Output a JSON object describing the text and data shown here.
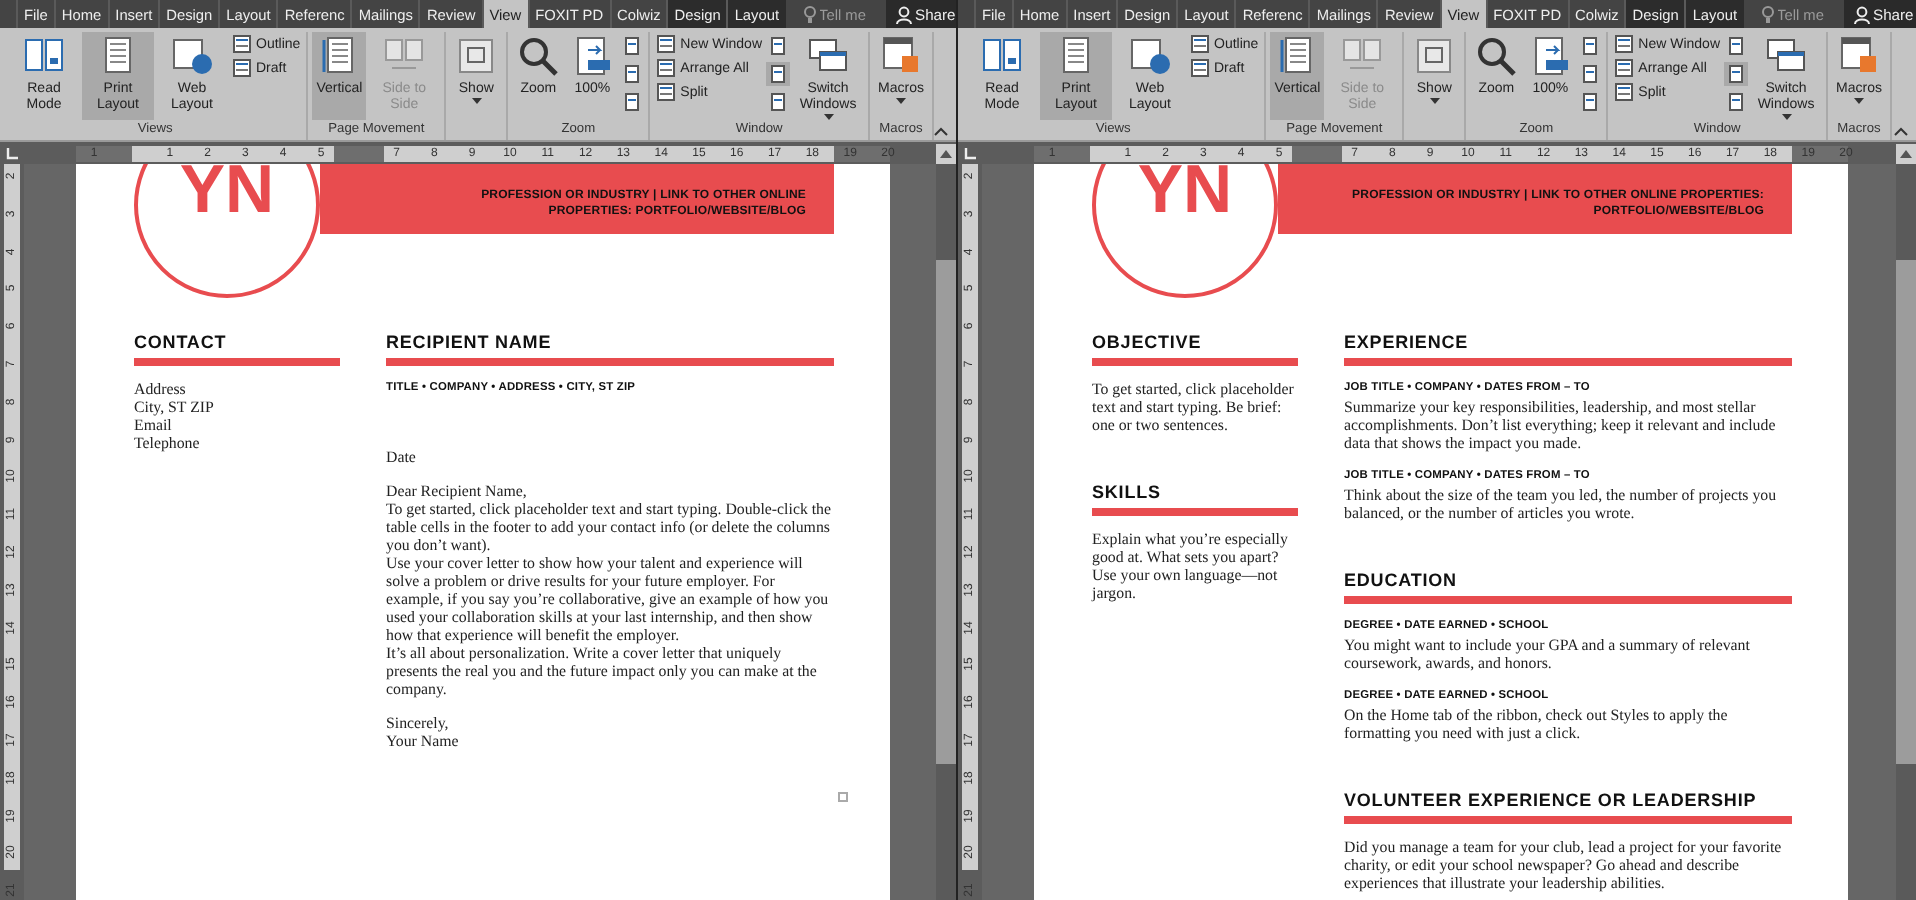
{
  "windows": [
    {
      "tabs": [
        {
          "label": "File",
          "selected": false,
          "kind": "normal"
        },
        {
          "label": "Home",
          "selected": false,
          "kind": "normal"
        },
        {
          "label": "Insert",
          "selected": false,
          "kind": "normal"
        },
        {
          "label": "Design",
          "selected": false,
          "kind": "normal"
        },
        {
          "label": "Layout",
          "selected": false,
          "kind": "normal"
        },
        {
          "label": "Referenc",
          "selected": false,
          "kind": "normal"
        },
        {
          "label": "Mailings",
          "selected": false,
          "kind": "normal"
        },
        {
          "label": "Review",
          "selected": false,
          "kind": "normal"
        },
        {
          "label": "View",
          "selected": true,
          "kind": "normal"
        },
        {
          "label": "FOXIT PD",
          "selected": false,
          "kind": "normal"
        },
        {
          "label": "Colwiz",
          "selected": false,
          "kind": "normal"
        },
        {
          "label": "Design",
          "selected": false,
          "kind": "contextual"
        },
        {
          "label": "Layout",
          "selected": false,
          "kind": "contextual"
        }
      ],
      "tell_me": {
        "placeholder": "Tell me"
      },
      "share_button": "Share",
      "ribbon": {
        "groups": [
          {
            "label": "Views",
            "items": [
              {
                "kind": "large",
                "label": "Read Mode",
                "selected": false,
                "disabled": false,
                "dropdown": false
              },
              {
                "kind": "large",
                "label": "Print Layout",
                "selected": true,
                "disabled": false,
                "dropdown": false
              },
              {
                "kind": "large",
                "label": "Web Layout",
                "selected": false,
                "disabled": false,
                "dropdown": false
              },
              {
                "kind": "stack",
                "items": [
                  {
                    "label": "Outline"
                  },
                  {
                    "label": "Draft"
                  }
                ]
              }
            ]
          },
          {
            "label": "Page Movement",
            "items": [
              {
                "kind": "large",
                "label": "Vertical",
                "selected": true,
                "disabled": false,
                "dropdown": false
              },
              {
                "kind": "large",
                "label": "Side to Side",
                "selected": false,
                "disabled": true,
                "dropdown": false
              }
            ]
          },
          {
            "items": [
              {
                "kind": "large",
                "label": "Show",
                "selected": false,
                "disabled": false,
                "dropdown": true
              }
            ]
          },
          {
            "label": "Zoom",
            "items": [
              {
                "kind": "large",
                "label": "Zoom",
                "selected": false,
                "disabled": false,
                "dropdown": false
              },
              {
                "kind": "large",
                "label": "100%",
                "selected": false,
                "disabled": false,
                "dropdown": false
              },
              {
                "kind": "icon_stack",
                "buttons": [
                  {
                    "selected": false
                  },
                  {
                    "selected": false
                  },
                  {
                    "selected": false
                  }
                ]
              }
            ]
          },
          {
            "label": "Window",
            "items": [
              {
                "kind": "stack",
                "items": [
                  {
                    "label": "New Window"
                  },
                  {
                    "label": "Arrange All"
                  },
                  {
                    "label": "Split"
                  }
                ]
              },
              {
                "kind": "icon_stack",
                "buttons": [
                  {
                    "selected": false
                  },
                  {
                    "selected": true
                  },
                  {
                    "selected": false
                  }
                ]
              },
              {
                "kind": "large",
                "label": "Switch Windows",
                "selected": false,
                "disabled": false,
                "dropdown": true
              }
            ]
          },
          {
            "label": "Macros",
            "items": [
              {
                "kind": "large",
                "label": "Macros",
                "selected": false,
                "disabled": false,
                "dropdown": true
              }
            ]
          }
        ]
      },
      "ruler": {
        "horizontal": [
          "1",
          "1",
          "2",
          "3",
          "4",
          "5",
          "7",
          "8",
          "9",
          "10",
          "11",
          "12",
          "13",
          "14",
          "15",
          "16",
          "17",
          "18",
          "19",
          "20"
        ],
        "vertical": [
          "2",
          "3",
          "4",
          "5",
          "6",
          "7",
          "8",
          "9",
          "10",
          "11",
          "12",
          "13",
          "14",
          "15",
          "16",
          "17",
          "18",
          "19",
          "20",
          "21"
        ]
      },
      "document": {
        "monogram": "YN",
        "header_lines": [
          "PROFESSION OR INDUSTRY | LINK TO OTHER ONLINE",
          "PROPERTIES: PORTFOLIO/WEBSITE/BLOG"
        ],
        "end_mark": true,
        "left_column": [
          {
            "heading": "CONTACT",
            "blocks": [
              {
                "kind": "text",
                "lines": [
                  "Address",
                  "City, ST ZIP",
                  "Email",
                  "Telephone"
                ]
              }
            ]
          }
        ],
        "right_column": [
          {
            "heading": "RECIPIENT NAME",
            "blocks": [
              {
                "kind": "address_line",
                "text": "TITLE • COMPANY • ADDRESS • CITY, ST ZIP"
              },
              {
                "kind": "text",
                "lines": [
                  "Date"
                ]
              },
              {
                "kind": "text",
                "lines": [
                  "Dear Recipient Name,",
                  "To get started, click placeholder text and start typing. Double-click the table cells in the footer to add your contact info (or delete the columns you don’t want).",
                  "Use your cover letter to show how your talent and experience will solve a problem or drive results for your future employer. For example, if you say you’re collaborative, give an example of how you used your collaboration skills at your last internship, and then show how that experience will benefit the employer.",
                  "It’s all about personalization. Write a cover letter that uniquely presents the real you and the future impact only you can make at the company."
                ]
              },
              {
                "kind": "text",
                "lines": [
                  "Sincerely,",
                  "Your Name"
                ]
              }
            ]
          }
        ]
      }
    },
    {
      "tabs": [
        {
          "label": "File",
          "selected": false,
          "kind": "normal"
        },
        {
          "label": "Home",
          "selected": false,
          "kind": "normal"
        },
        {
          "label": "Insert",
          "selected": false,
          "kind": "normal"
        },
        {
          "label": "Design",
          "selected": false,
          "kind": "normal"
        },
        {
          "label": "Layout",
          "selected": false,
          "kind": "normal"
        },
        {
          "label": "Referenc",
          "selected": false,
          "kind": "normal"
        },
        {
          "label": "Mailings",
          "selected": false,
          "kind": "normal"
        },
        {
          "label": "Review",
          "selected": false,
          "kind": "normal"
        },
        {
          "label": "View",
          "selected": true,
          "kind": "normal"
        },
        {
          "label": "FOXIT PD",
          "selected": false,
          "kind": "normal"
        },
        {
          "label": "Colwiz",
          "selected": false,
          "kind": "normal"
        },
        {
          "label": "Design",
          "selected": false,
          "kind": "contextual"
        },
        {
          "label": "Layout",
          "selected": false,
          "kind": "contextual"
        }
      ],
      "tell_me": {
        "placeholder": "Tell me"
      },
      "share_button": "Share",
      "ribbon": {
        "groups": [
          {
            "label": "Views",
            "items": [
              {
                "kind": "large",
                "label": "Read Mode",
                "selected": false,
                "disabled": false,
                "dropdown": false
              },
              {
                "kind": "large",
                "label": "Print Layout",
                "selected": true,
                "disabled": false,
                "dropdown": false
              },
              {
                "kind": "large",
                "label": "Web Layout",
                "selected": false,
                "disabled": false,
                "dropdown": false
              },
              {
                "kind": "stack",
                "items": [
                  {
                    "label": "Outline"
                  },
                  {
                    "label": "Draft"
                  }
                ]
              }
            ]
          },
          {
            "label": "Page Movement",
            "items": [
              {
                "kind": "large",
                "label": "Vertical",
                "selected": true,
                "disabled": false,
                "dropdown": false
              },
              {
                "kind": "large",
                "label": "Side to Side",
                "selected": false,
                "disabled": true,
                "dropdown": false
              }
            ]
          },
          {
            "items": [
              {
                "kind": "large",
                "label": "Show",
                "selected": false,
                "disabled": false,
                "dropdown": true
              }
            ]
          },
          {
            "label": "Zoom",
            "items": [
              {
                "kind": "large",
                "label": "Zoom",
                "selected": false,
                "disabled": false,
                "dropdown": false
              },
              {
                "kind": "large",
                "label": "100%",
                "selected": false,
                "disabled": false,
                "dropdown": false
              },
              {
                "kind": "icon_stack",
                "buttons": [
                  {
                    "selected": false
                  },
                  {
                    "selected": false
                  },
                  {
                    "selected": false
                  }
                ]
              }
            ]
          },
          {
            "label": "Window",
            "items": [
              {
                "kind": "stack",
                "items": [
                  {
                    "label": "New Window"
                  },
                  {
                    "label": "Arrange All"
                  },
                  {
                    "label": "Split"
                  }
                ]
              },
              {
                "kind": "icon_stack",
                "buttons": [
                  {
                    "selected": false
                  },
                  {
                    "selected": true
                  },
                  {
                    "selected": false
                  }
                ]
              },
              {
                "kind": "large",
                "label": "Switch Windows",
                "selected": false,
                "disabled": false,
                "dropdown": true
              }
            ]
          },
          {
            "label": "Macros",
            "items": [
              {
                "kind": "large",
                "label": "Macros",
                "selected": false,
                "disabled": false,
                "dropdown": true
              }
            ]
          }
        ]
      },
      "ruler": {
        "horizontal": [
          "1",
          "1",
          "2",
          "3",
          "4",
          "5",
          "7",
          "8",
          "9",
          "10",
          "11",
          "12",
          "13",
          "14",
          "15",
          "16",
          "17",
          "18",
          "19",
          "20"
        ],
        "vertical": [
          "2",
          "3",
          "4",
          "5",
          "6",
          "7",
          "8",
          "9",
          "10",
          "11",
          "12",
          "13",
          "14",
          "15",
          "16",
          "17",
          "18",
          "19",
          "20",
          "21"
        ]
      },
      "document": {
        "monogram": "YN",
        "header_lines": [
          "PROFESSION OR INDUSTRY | LINK TO OTHER ONLINE PROPERTIES:",
          "PORTFOLIO/WEBSITE/BLOG"
        ],
        "end_mark": false,
        "left_column": [
          {
            "heading": "OBJECTIVE",
            "blocks": [
              {
                "kind": "text",
                "lines": [
                  "To get started, click placeholder text and start typing. Be brief: one or two sentences."
                ]
              }
            ]
          },
          {
            "heading": "SKILLS",
            "blocks": [
              {
                "kind": "text",
                "lines": [
                  "Explain what you’re especially good at. What sets you apart? Use your own language—not jargon."
                ]
              }
            ]
          }
        ],
        "right_column": [
          {
            "heading": "EXPERIENCE",
            "blocks": [
              {
                "kind": "subhead",
                "text": "JOB TITLE • COMPANY • DATES FROM – TO"
              },
              {
                "kind": "text",
                "lines": [
                  "Summarize your key responsibilities, leadership, and most stellar accomplishments. Don’t list everything; keep it relevant and include data that shows the impact you made."
                ]
              },
              {
                "kind": "subhead",
                "text": "JOB TITLE • COMPANY • DATES FROM – TO"
              },
              {
                "kind": "text",
                "lines": [
                  "Think about the size of the team you led, the number of projects you balanced, or the number of articles you wrote."
                ]
              }
            ]
          },
          {
            "heading": "EDUCATION",
            "blocks": [
              {
                "kind": "subhead",
                "text": "DEGREE • DATE EARNED • SCHOOL"
              },
              {
                "kind": "text",
                "lines": [
                  "You might want to include your GPA and a summary of relevant coursework, awards, and honors."
                ]
              },
              {
                "kind": "subhead",
                "text": "DEGREE • DATE EARNED • SCHOOL"
              },
              {
                "kind": "text",
                "lines": [
                  "On the Home tab of the ribbon, check out Styles to apply the formatting you need with just a click."
                ]
              }
            ]
          },
          {
            "heading": "VOLUNTEER EXPERIENCE OR LEADERSHIP",
            "blocks": [
              {
                "kind": "text",
                "lines": [
                  "Did you manage a team for your club, lead a project for your favorite charity, or edit your school newspaper? Go ahead and describe experiences that illustrate your leadership abilities."
                ]
              }
            ]
          }
        ]
      }
    }
  ]
}
